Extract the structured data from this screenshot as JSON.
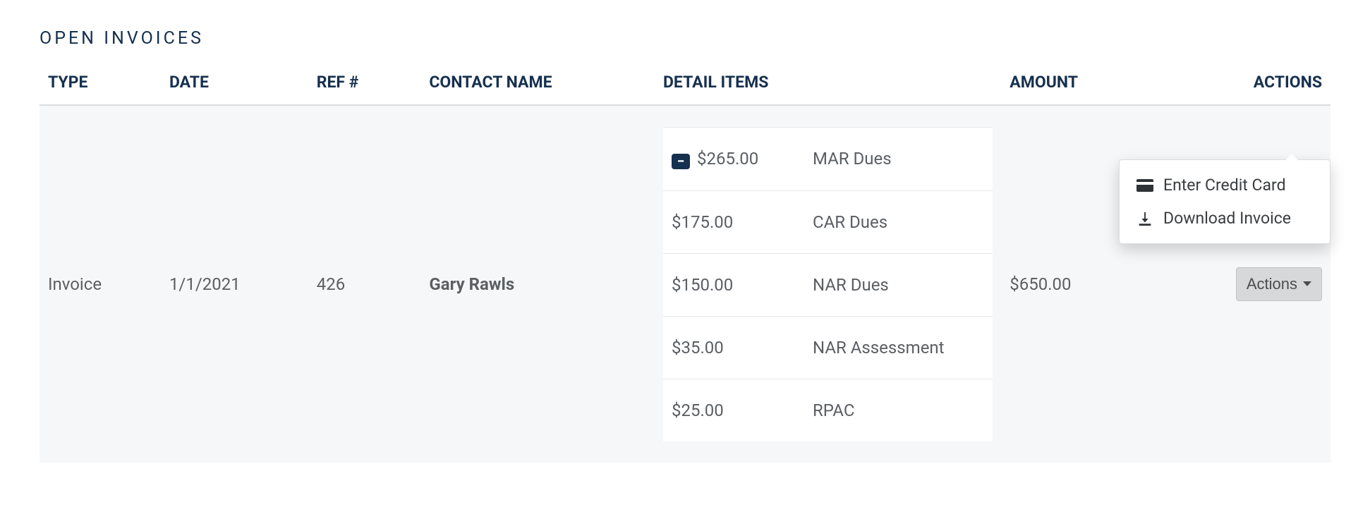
{
  "section_title": "OPEN INVOICES",
  "columns": {
    "type": "TYPE",
    "date": "DATE",
    "ref": "REF #",
    "contact": "CONTACT NAME",
    "detail": "DETAIL ITEMS",
    "amount": "AMOUNT",
    "actions": "ACTIONS"
  },
  "rows": [
    {
      "type": "Invoice",
      "date": "1/1/2021",
      "ref": "426",
      "contact": "Gary Rawls",
      "amount": "$650.00",
      "detail_items": [
        {
          "price": "$265.00",
          "desc": "MAR Dues",
          "badge": true
        },
        {
          "price": "$175.00",
          "desc": "CAR Dues",
          "badge": false
        },
        {
          "price": "$150.00",
          "desc": "NAR Dues",
          "badge": false
        },
        {
          "price": "$35.00",
          "desc": "NAR Assessment",
          "badge": false
        },
        {
          "price": "$25.00",
          "desc": "RPAC",
          "badge": false
        }
      ]
    }
  ],
  "actions_button_label": "Actions",
  "dropdown": {
    "enter_card": "Enter Credit Card",
    "download": "Download Invoice"
  }
}
